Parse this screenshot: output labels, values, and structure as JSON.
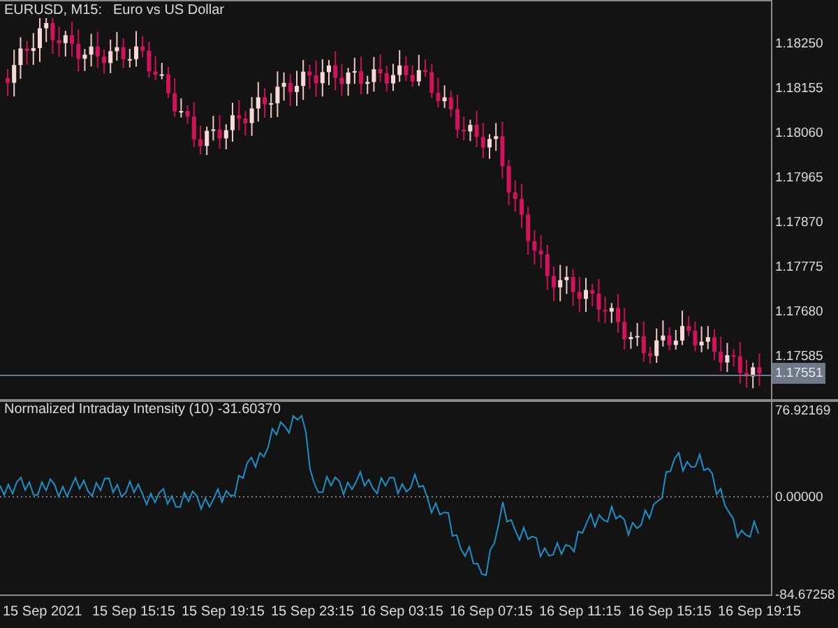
{
  "window": {
    "symbol": "EURUSD, M15:",
    "description": "Euro vs US Dollar"
  },
  "price_axis": {
    "labels": [
      "1.18250",
      "1.18155",
      "1.18060",
      "1.17965",
      "1.17870",
      "1.17775",
      "1.17680",
      "1.17585"
    ],
    "current_price": "1.17551"
  },
  "indicator": {
    "title": "Normalized Intraday Intensity (10) -31.60370",
    "axis_labels": [
      "76.92169",
      "0.00000",
      "-84.67258"
    ]
  },
  "time_axis": {
    "labels": [
      "15 Sep 2021",
      "15 Sep 15:15",
      "15 Sep 19:15",
      "15 Sep 23:15",
      "16 Sep 03:15",
      "16 Sep 07:15",
      "16 Sep 11:15",
      "16 Sep 15:15",
      "16 Sep 19:15"
    ]
  }
}
